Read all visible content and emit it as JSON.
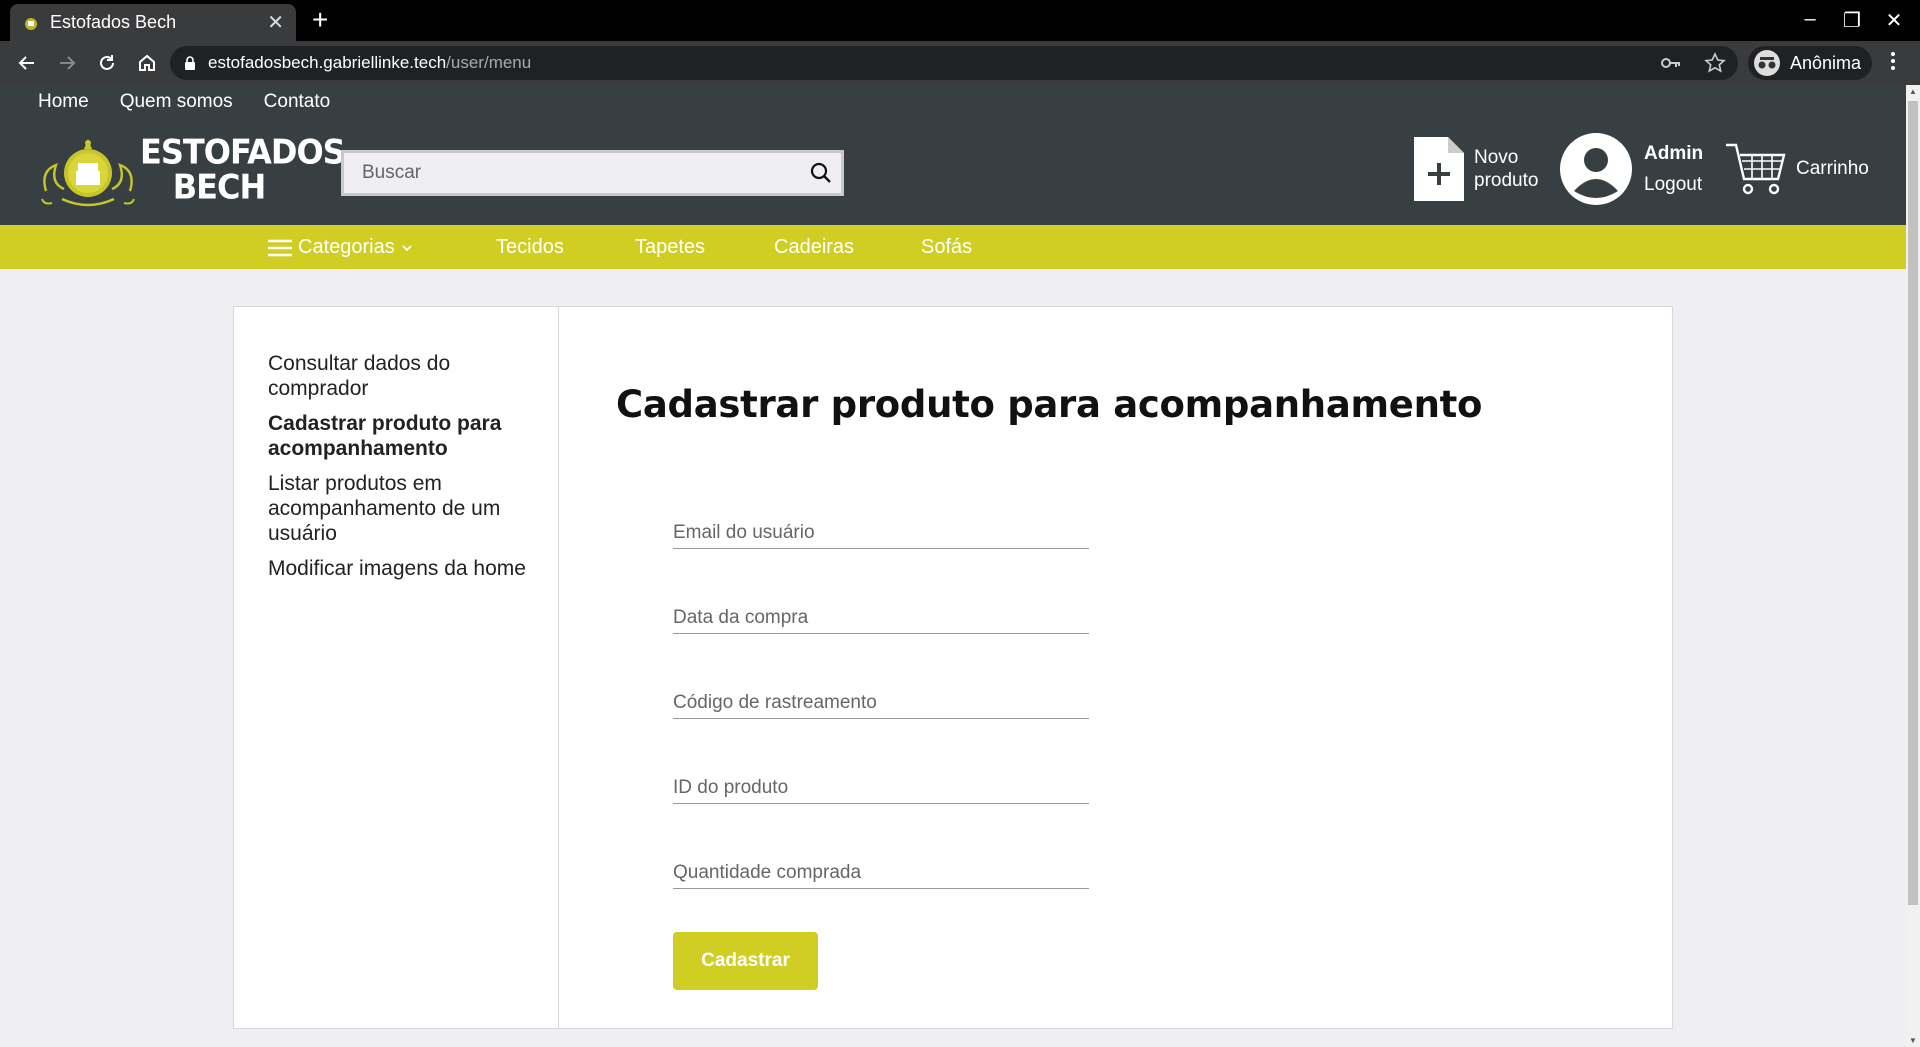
{
  "browser": {
    "tab_title": "Estofados Bech",
    "url_host": "estofadosbech.gabriellinke.tech",
    "url_path": "/user/menu",
    "profile_label": "Anônima"
  },
  "site": {
    "topnav": [
      "Home",
      "Quem somos",
      "Contato"
    ],
    "logo_line1": "ESTOFADOS",
    "logo_line2": "BECH",
    "search_placeholder": "Buscar",
    "new_product_line1": "Novo",
    "new_product_line2": "produto",
    "user_name": "Admin",
    "logout_label": "Logout",
    "cart_label": "Carrinho",
    "categories_label": "Categorias",
    "categories": [
      "Tecidos",
      "Tapetes",
      "Cadeiras",
      "Sofás"
    ],
    "accent_color": "#d0ce22",
    "header_color": "#373f42"
  },
  "sidebar": {
    "items": [
      {
        "label": "Consultar dados do comprador"
      },
      {
        "label": "Cadastrar produto para acompanhamento"
      },
      {
        "label": "Listar produtos em acompanhamento de um usuário"
      },
      {
        "label": "Modificar imagens da home"
      }
    ],
    "active": "Cadastrar produto para acompanhamento"
  },
  "form": {
    "title": "Cadastrar produto para acompanhamento",
    "fields": [
      {
        "placeholder": "Email do usuário"
      },
      {
        "placeholder": "Data da compra"
      },
      {
        "placeholder": "Código de rastreamento"
      },
      {
        "placeholder": "ID do produto"
      },
      {
        "placeholder": "Quantidade comprada"
      }
    ],
    "submit_label": "Cadastrar"
  }
}
